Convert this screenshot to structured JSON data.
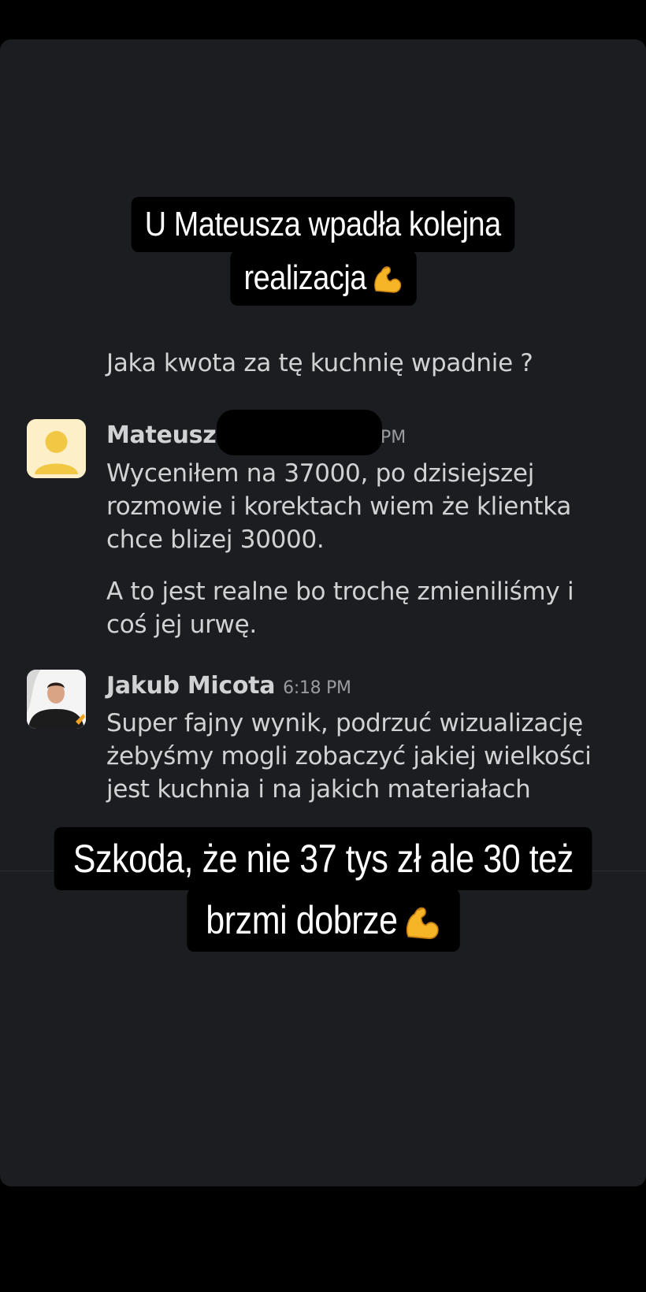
{
  "story": {
    "caption_top": {
      "line1": "U Mateusza wpadła kolejna",
      "line2": "realizacja"
    },
    "caption_bottom": {
      "line1": "Szkoda, że nie 37 tys zł ale 30 też",
      "line2": "brzmi dobrze"
    },
    "emoji_name": "flexed-biceps-emoji"
  },
  "chat": {
    "prev_message": "Jaka kwota za tę kuchnię wpadnie ?",
    "messages": [
      {
        "author": "Mateusz",
        "time_fragment": "PM",
        "paragraphs": [
          "Wyceniłem na 37000, po dzisiejszej rozmowie i korektach wiem że klientka chce blizej 30000.",
          "A to jest realne bo trochę zmieniliśmy i coś jej urwę."
        ],
        "avatar": "default-user-avatar"
      },
      {
        "author": "Jakub Micota",
        "time": "6:18 PM",
        "paragraphs": [
          "Super fajny wynik, podrzuć wizualizację żebyśmy mogli zobaczyć jakiej wielkości jest kuchnia i na jakich materiałach"
        ],
        "avatar": "profile-photo-avatar"
      }
    ]
  },
  "colors": {
    "background": "#1b1d21",
    "text": "#d1d2d3",
    "avatar_yellow": "#f2c744"
  }
}
